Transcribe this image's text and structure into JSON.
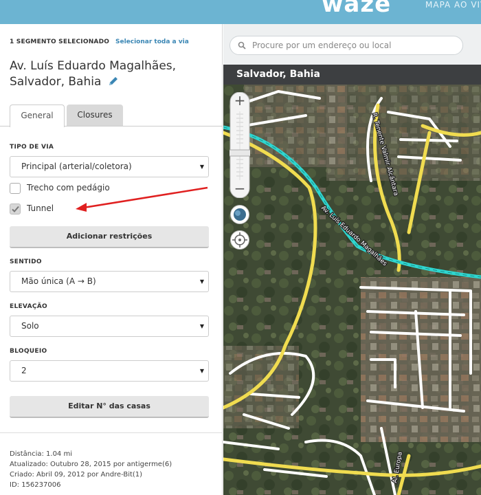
{
  "header": {
    "logo": "waze",
    "nav_link": "MAPA AO VIVO"
  },
  "sidebar": {
    "selection_count": "1 SEGMENTO SELECIONADO",
    "select_all_link": "Selecionar toda a via",
    "title_line1": "Av. Luís Eduardo Magalhães,",
    "title_line2": "Salvador, Bahia",
    "tabs": [
      {
        "label": "General",
        "active": true
      },
      {
        "label": "Closures",
        "active": false
      }
    ],
    "road_type": {
      "label": "TIPO DE VIA",
      "value": "Principal (arterial/coletora)"
    },
    "toll": {
      "label": "Trecho com pedágio",
      "checked": false
    },
    "tunnel": {
      "label": "Tunnel",
      "checked": true
    },
    "add_restrictions_button": "Adicionar restrições",
    "direction": {
      "label": "SENTIDO",
      "value": "Mão única (A → B)"
    },
    "elevation": {
      "label": "ELEVAÇÃO",
      "value": "Solo"
    },
    "lock": {
      "label": "BLOQUEIO",
      "value": "2"
    },
    "edit_house_numbers_button": "Editar N° das casas",
    "meta": {
      "distance": "Distância: 1.04 mi",
      "updated": "Atualizado: Outubro 28, 2015 por antigerme(6)",
      "created": "Criado: Abril 09, 2012 por Andre-Bit(1)",
      "id": "ID: 156237006"
    }
  },
  "map": {
    "search_placeholder": "Procure por um endereço ou local",
    "city_bar": "Salvador, Bahia",
    "street_labels": {
      "main": "Av. Luís Eduardo Magalhães",
      "north": "R. Tenente Valmir Alcântara",
      "south": "Al. Europa"
    },
    "colors": {
      "selected_segment": "#2fd6d0",
      "primary_street": "#f0dc50",
      "street": "#ffffff",
      "annotation_arrow": "#e02020"
    }
  }
}
